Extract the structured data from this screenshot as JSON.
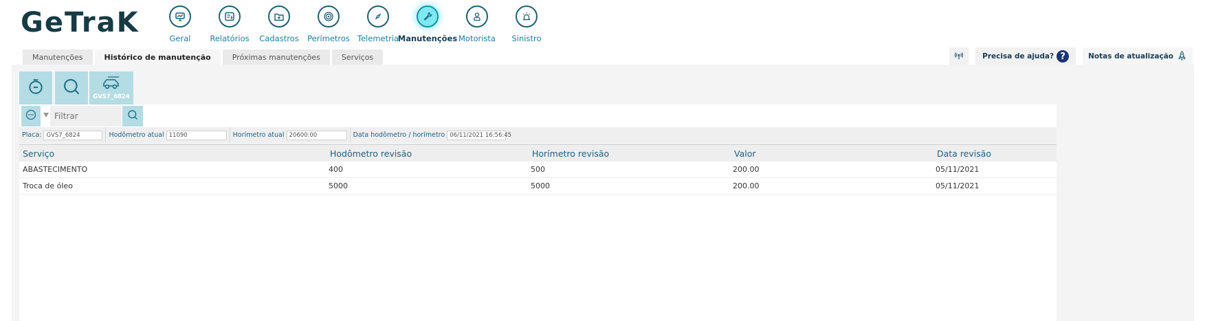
{
  "brand": {
    "logo_text": "GeTraK"
  },
  "nav": [
    {
      "label": "Geral",
      "icon": "chart-monitor-icon",
      "active": false
    },
    {
      "label": "Relatórios",
      "icon": "report-icon",
      "active": false
    },
    {
      "label": "Cadastros",
      "icon": "folder-plus-icon",
      "active": false
    },
    {
      "label": "Perímetros",
      "icon": "target-icon",
      "active": false
    },
    {
      "label": "Telemetria",
      "icon": "compass-icon",
      "active": false
    },
    {
      "label": "Manutenções",
      "icon": "wrench-icon",
      "active": true
    },
    {
      "label": "Motorista",
      "icon": "driver-icon",
      "active": false
    },
    {
      "label": "Sinistro",
      "icon": "alarm-icon",
      "active": false
    }
  ],
  "tabs": [
    {
      "label": "Manutenções",
      "active": false
    },
    {
      "label": "Histórico de manutenção",
      "active": true
    },
    {
      "label": "Próximas manutenções",
      "active": false
    },
    {
      "label": "Serviços",
      "active": false
    }
  ],
  "help": {
    "help_label": "Precisa de ajuda?",
    "help_glyph": "?",
    "notes_label": "Notas de atualização"
  },
  "toolbar": {
    "plate_label": "GVS7_6824"
  },
  "filter": {
    "placeholder": "Filtrar"
  },
  "info": {
    "placa_label": "Placa:",
    "placa_value": "GVS7_6824",
    "hodometro_label": "Hodômetro atual",
    "hodometro_value": "11090",
    "horimetro_label": "Horímetro atual",
    "horimetro_value": "20600:00",
    "data_label": "Data hodômetro / horímetro",
    "data_value": "06/11/2021 16:56:45"
  },
  "table": {
    "columns": [
      "Serviço",
      "Hodômetro revisão",
      "Horímetro revisão",
      "Valor",
      "Data revisão"
    ],
    "rows": [
      [
        "ABASTECIMENTO",
        "400",
        "500",
        "200.00",
        "05/11/2021"
      ],
      [
        "Troca de óleo",
        "5000",
        "5000",
        "200.00",
        "05/11/2021"
      ]
    ]
  },
  "colors": {
    "primary_dark": "#163b45",
    "accent": "#1f7d9c",
    "active_glow": "#7fe8f2",
    "tool_bg": "#b4dce4"
  }
}
